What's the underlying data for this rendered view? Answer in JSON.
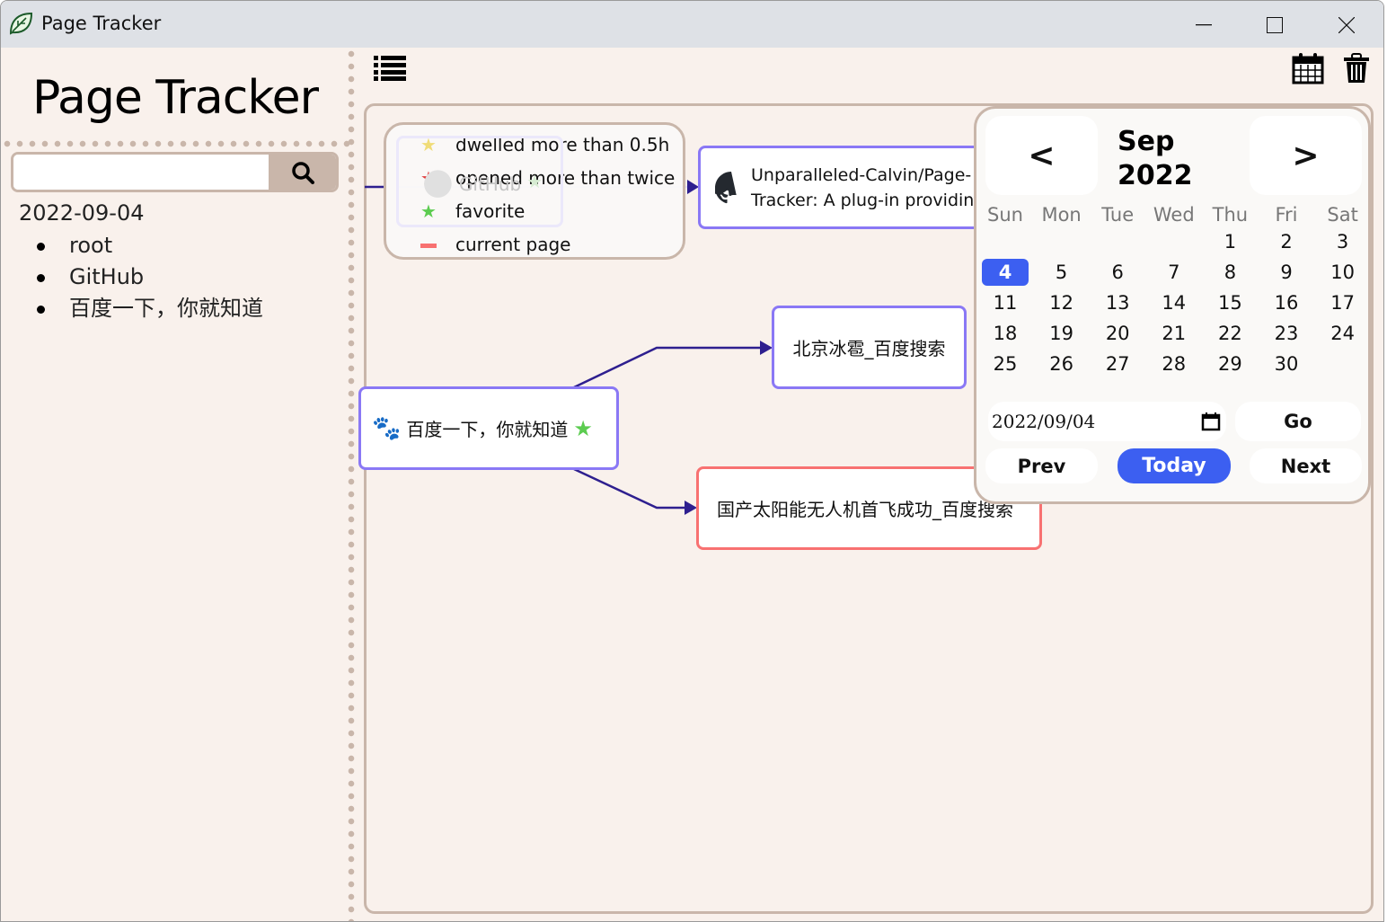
{
  "window": {
    "title": "Page Tracker",
    "icon": "leaf-icon",
    "controls": [
      "minimize",
      "maximize",
      "close"
    ]
  },
  "sidebar": {
    "title": "Page Tracker",
    "search": {
      "value": "",
      "placeholder": ""
    },
    "date": "2022-09-04",
    "pages": [
      {
        "label": "root"
      },
      {
        "label": "GitHub"
      },
      {
        "label": "百度一下，你就知道"
      }
    ]
  },
  "toolbar": {
    "list_icon": "list-icon",
    "calendar_icon": "calendar-icon",
    "trash_icon": "trash-icon"
  },
  "legend": [
    {
      "icon": "star",
      "color": "#f0dc78",
      "label": "dwelled more than 0.5h"
    },
    {
      "icon": "star",
      "color": "#e03c3c",
      "label": "opened more than twice"
    },
    {
      "icon": "star",
      "color": "#5ccc50",
      "label": "favorite"
    },
    {
      "icon": "dash",
      "color": "#f87171",
      "label": "current page"
    }
  ],
  "graph": {
    "nodes": [
      {
        "id": "github",
        "label": "GitHub",
        "favorite": true
      },
      {
        "id": "repo",
        "label_line1": "Unparalleled-Calvin/Page-",
        "label_line2": "Tracker: A plug-in providing frie..."
      },
      {
        "id": "baidu",
        "label": "百度一下，你就知道",
        "favorite": true
      },
      {
        "id": "hail",
        "label": "北京冰雹_百度搜索"
      },
      {
        "id": "drone",
        "label": "国产太阳能无人机首飞成功_百度搜索",
        "current": true
      }
    ],
    "colors": {
      "node_border": "#8a78f5",
      "current_border": "#f87171",
      "edge": "#2e1f8f"
    }
  },
  "calendar": {
    "month": "Sep",
    "year": "2022",
    "prev_label": "<",
    "next_label": ">",
    "weekdays": [
      "Sun",
      "Mon",
      "Tue",
      "Wed",
      "Thu",
      "Fri",
      "Sat"
    ],
    "first_weekday": 4,
    "days_in_month": 30,
    "selected": 4,
    "date_input": "2022/09/04",
    "go": "Go",
    "prev": "Prev",
    "today": "Today",
    "next": "Next",
    "accent": "#3c5ff1"
  }
}
